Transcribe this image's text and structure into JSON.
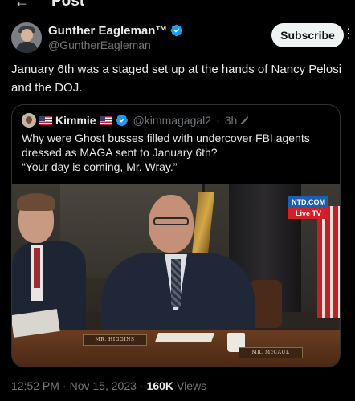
{
  "top_bar": {
    "back_icon": "arrow-left-icon",
    "title": "Post"
  },
  "author": {
    "display_name": "Gunther Eagleman™",
    "handle": "@GuntherEagleman",
    "verified_icon": "verified-badge-icon",
    "verified_color": "#1d9bf0"
  },
  "subscribe_label": "Subscribe",
  "more_icon": "more-vertical-icon",
  "tweet_text": "January 6th was a staged set up at the hands of Nancy Pelosi and the DOJ.",
  "quote": {
    "display_name": "Kimmie",
    "flag_icon": "us-flag-icon",
    "verified_icon": "verified-badge-icon",
    "handle": "@kimmagagal2",
    "separator": "·",
    "time": "3h",
    "edited_icon": "pencil-icon",
    "text_line1": "Why were Ghost busses filled with undercover FBI agents dressed as MAGA sent to January 6th?",
    "text_line2": "“Your day is coming, Mr. Wray.”",
    "media": {
      "ntd_top": "NTD.COM",
      "ntd_bottom": "Live TV",
      "placard1": "MR. HIGGINS",
      "placard2": "MR. McCAUL"
    }
  },
  "footer": {
    "time": "12:52 PM",
    "separator": "·",
    "date": "Nov 15, 2023",
    "views_count": "160K",
    "views_label": "Views"
  },
  "colors": {
    "background": "#000000",
    "text_primary": "#e7e9ea",
    "text_secondary": "#71767b",
    "border": "#2f3336",
    "subscribe_bg": "#eff3f4"
  }
}
